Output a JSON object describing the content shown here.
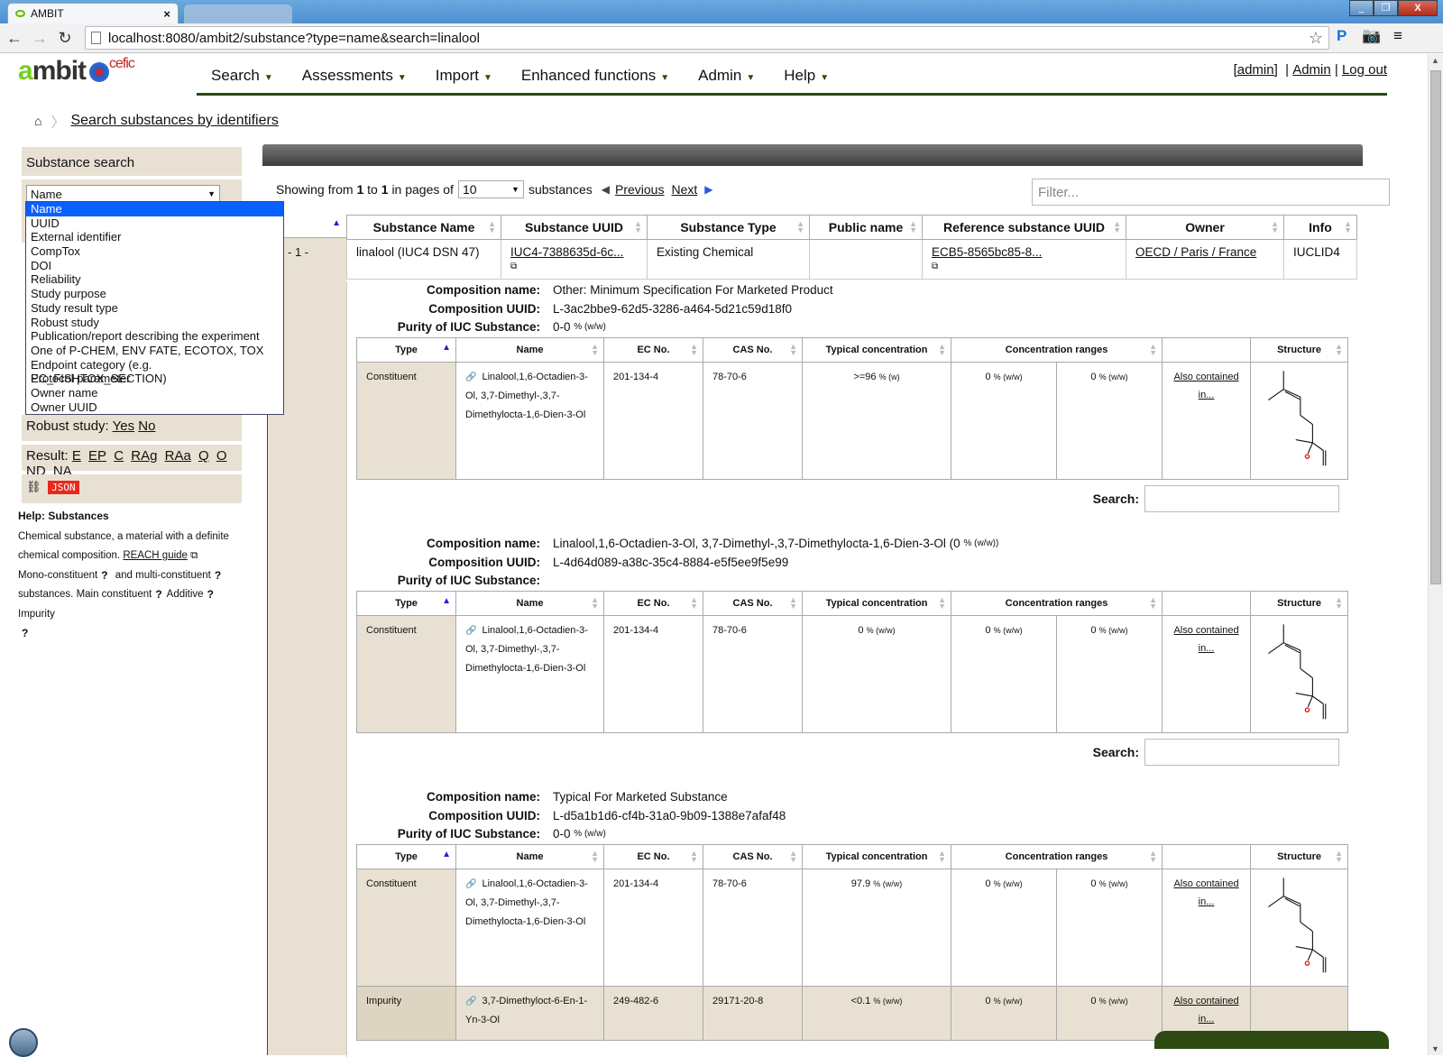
{
  "browser": {
    "tab_title": "AMBIT",
    "second_tab_title": "",
    "url": "localhost:8080/ambit2/substance?type=name&search=linalool",
    "window_buttons": [
      "minimize",
      "restore",
      "close"
    ]
  },
  "header": {
    "logo_text_a": "a",
    "logo_text_rest": "mbit",
    "logo_partner": "cefic",
    "nav": [
      {
        "label": "Search"
      },
      {
        "label": "Assessments"
      },
      {
        "label": "Import"
      },
      {
        "label": "Enhanced functions"
      },
      {
        "label": "Admin"
      },
      {
        "label": "Help"
      }
    ],
    "user_bracket": "[admin]",
    "admin_link": "Admin",
    "logout_link": "Log out"
  },
  "breadcrumb": {
    "label": "Search substances by identifiers"
  },
  "sidebar": {
    "title": "Substance search",
    "search_type_selected": "Name",
    "search_type_options": [
      "Name",
      "UUID",
      "External identifier",
      "CompTox",
      "DOI",
      "Reliability",
      "Study purpose",
      "Study result type",
      "Robust study",
      "Publication/report describing the experiment",
      "One of P-CHEM, ENV FATE, ECOTOX, TOX",
      "Endpoint category (e.g. EC_FISHTOX_SECTION)",
      "Protocol parameter",
      "Owner name",
      "Owner UUID"
    ],
    "robust_label": "Robust study:",
    "robust_yes": "Yes",
    "robust_no": "No",
    "result_label": "Result:",
    "result_links": [
      "E",
      "EP",
      "C",
      "RAg",
      "RAa",
      "Q",
      "O",
      "ND",
      "NA"
    ],
    "json_label": "JSON",
    "help_title": "Help: Substances",
    "help_line1": "Chemical substance, a material with a definite",
    "help_line2": "chemical composition.",
    "help_reach": "REACH guide",
    "help_mono": "Mono-constituent",
    "help_and_multi": "and multi-constituent",
    "help_substances": "substances. Main constituent",
    "help_additive": "Additive",
    "help_impurity": "Impurity",
    "q": "?"
  },
  "paging": {
    "showing_from": "Showing from",
    "from": "1",
    "to_word": "to",
    "to": "1",
    "in_pages_of": "in pages of",
    "page_size": "10",
    "substances": "substances",
    "previous": "Previous",
    "next": "Next",
    "filter_placeholder": "Filter..."
  },
  "substance_table": {
    "columns": [
      "Substance Name",
      "Substance UUID",
      "Substance Type",
      "Public name",
      "Reference substance UUID",
      "Owner",
      "Info"
    ],
    "rows": [
      {
        "index": "- 1 -",
        "name": "linalool (IUC4 DSN 47)",
        "uuid": "IUC4-7388635d-6c...",
        "type": "Existing Chemical",
        "public_name": "",
        "ref_uuid": "ECB5-8565bc85-8...",
        "owner": "OECD / Paris / France",
        "info": "IUCLID4"
      }
    ]
  },
  "composition_labels": {
    "name": "Composition name:",
    "uuid": "Composition UUID:",
    "purity": "Purity of IUC Substance:",
    "search": "Search:",
    "also": "Also contained",
    "in": "in...",
    "columns": [
      "Type",
      "Name",
      "EC No.",
      "CAS No.",
      "Typical concentration",
      "Concentration ranges",
      "",
      "Structure"
    ]
  },
  "compositions": [
    {
      "name": "Other: Minimum Specification For Marketed Product",
      "uuid": "L-3ac2bbe9-62d5-3286-a464-5d21c59d18f0",
      "purity": "0-0",
      "purity_unit": "% (w/w)",
      "rows": [
        {
          "type": "Constituent",
          "name": "Linalool,1,6-Octadien-3-Ol, 3,7-Dimethyl-,3,7-Dimethylocta-1,6-Dien-3-Ol",
          "ec": "201-134-4",
          "cas": "78-70-6",
          "typical": ">=96",
          "typical_unit": "% (w)",
          "range_low": "0",
          "range_high": "0",
          "range_unit": "% (w/w)"
        }
      ]
    },
    {
      "name": "Linalool,1,6-Octadien-3-Ol, 3,7-Dimethyl-,3,7-Dimethylocta-1,6-Dien-3-Ol (0",
      "name_unit": "% (w/w))",
      "uuid": "L-4d64d089-a38c-35c4-8884-e5f5ee9f5e99",
      "purity": "",
      "purity_unit": "",
      "rows": [
        {
          "type": "Constituent",
          "name": "Linalool,1,6-Octadien-3-Ol, 3,7-Dimethyl-,3,7-Dimethylocta-1,6-Dien-3-Ol",
          "ec": "201-134-4",
          "cas": "78-70-6",
          "typical": "0",
          "typical_unit": "% (w/w)",
          "range_low": "0",
          "range_high": "0",
          "range_unit": "% (w/w)"
        }
      ]
    },
    {
      "name": "Typical For Marketed Substance",
      "uuid": "L-d5a1b1d6-cf4b-31a0-9b09-1388e7afaf48",
      "purity": "0-0",
      "purity_unit": "% (w/w)",
      "rows": [
        {
          "type": "Constituent",
          "name": "Linalool,1,6-Octadien-3-Ol, 3,7-Dimethyl-,3,7-Dimethylocta-1,6-Dien-3-Ol",
          "ec": "201-134-4",
          "cas": "78-70-6",
          "typical": "97.9",
          "typical_unit": "% (w/w)",
          "range_low": "0",
          "range_high": "0",
          "range_unit": "% (w/w)"
        },
        {
          "type": "Impurity",
          "name": "3,7-Dimethyloct-6-En-1-Yn-3-Ol",
          "ec": "249-482-6",
          "cas": "29171-20-8",
          "typical": "<0.1",
          "typical_unit": "% (w/w)",
          "range_low": "0",
          "range_high": "0",
          "range_unit": "% (w/w)"
        }
      ]
    }
  ]
}
